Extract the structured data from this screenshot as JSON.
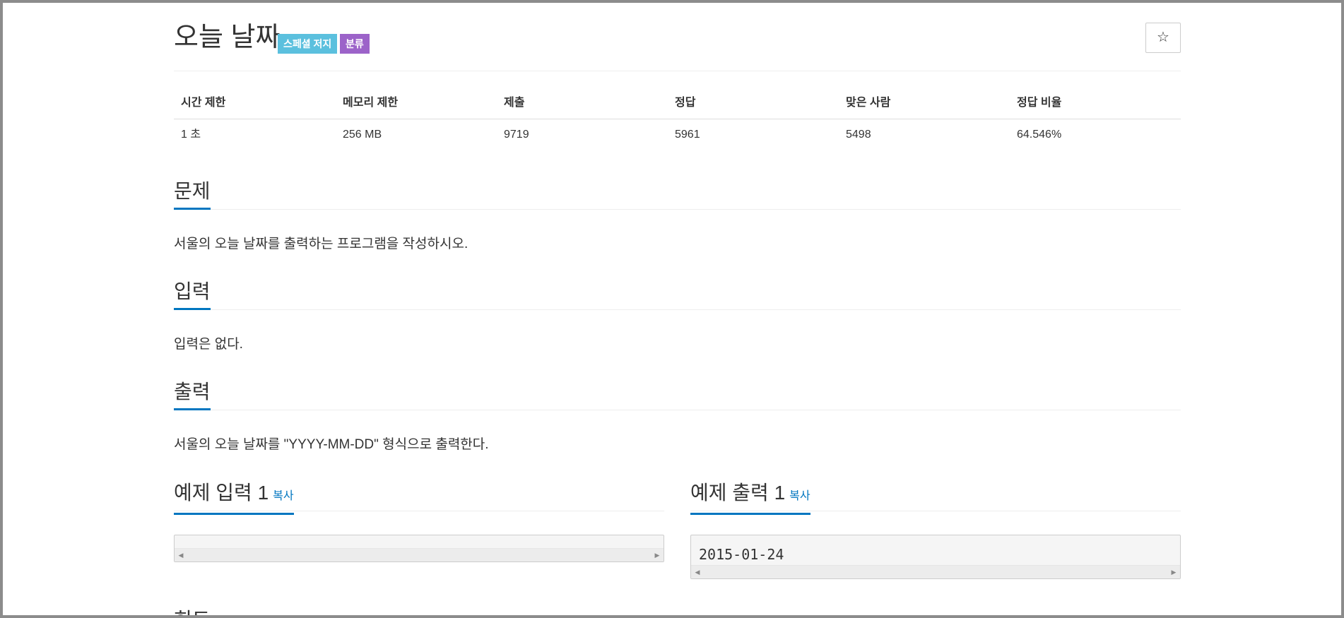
{
  "problem": {
    "title": "오늘 날짜",
    "labels": {
      "special_judge": "스페셜 저지",
      "category": "분류"
    },
    "star_icon": "☆"
  },
  "stats": {
    "headers": [
      "시간 제한",
      "메모리 제한",
      "제출",
      "정답",
      "맞은 사람",
      "정답 비율"
    ],
    "values": [
      "1 초",
      "256 MB",
      "9719",
      "5961",
      "5498",
      "64.546%"
    ]
  },
  "sections": {
    "description": {
      "title": "문제",
      "text": "서울의 오늘 날짜를 출력하는 프로그램을 작성하시오."
    },
    "input": {
      "title": "입력",
      "text": "입력은 없다."
    },
    "output": {
      "title": "출력",
      "text": "서울의 오늘 날짜를 \"YYYY-MM-DD\" 형식으로 출력한다."
    }
  },
  "samples": {
    "input": {
      "title": "예제 입력 1",
      "copy_label": "복사",
      "content": ""
    },
    "output": {
      "title": "예제 출력 1",
      "copy_label": "복사",
      "content": "2015-01-24"
    }
  },
  "next_section_partial": "힌트",
  "colors": {
    "accent": "#0076c0",
    "label_special": "#5bc0de",
    "label_category": "#9c63c9"
  }
}
